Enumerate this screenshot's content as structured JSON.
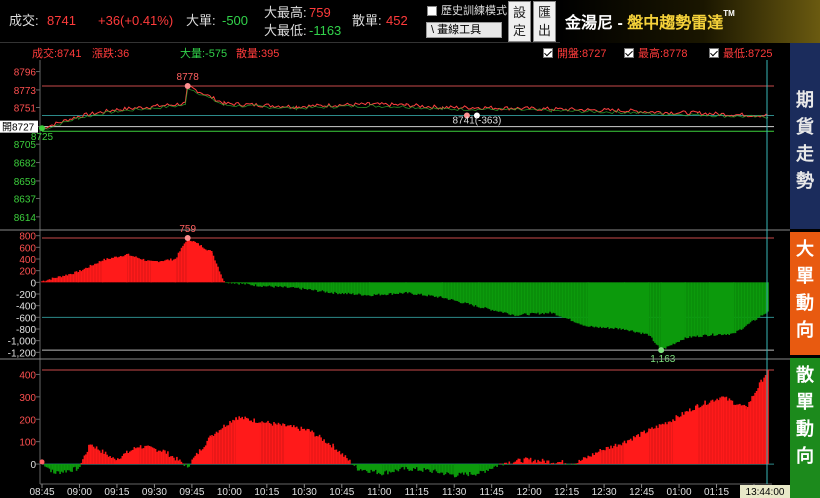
{
  "topbar": {
    "trade_label": "成交:",
    "trade_value": "8741",
    "change_value": "+36(+0.41%)",
    "big_label": "大單:",
    "big_value": "-500",
    "big_max_label": "大最高:",
    "big_max_value": "759",
    "big_min_label": "大最低:",
    "big_min_value": "-1163",
    "retail_label": "散單:",
    "retail_value": "452",
    "history_mode_label": "歷史訓練模式",
    "draw_tool_label": "\\ 畫線工具",
    "settings_label": "設定",
    "export_label": "匯出"
  },
  "brand": {
    "name": "金湯尼",
    "dash": " - ",
    "product": "盤中趨勢雷達",
    "tm": "TM"
  },
  "legend": {
    "trade_text": "成交:8741",
    "change_text": "漲跌:36",
    "big_text": "大量:-575",
    "retail_text": "散量:395",
    "open_text": "開盤:8727",
    "high_text": "最高:8778",
    "low_text": "最低:8725"
  },
  "side_tabs": {
    "futures_trend": "期貨走勢",
    "big_direction": "大單動向",
    "retail_direction": "散單動向"
  },
  "chart_data": [
    {
      "type": "line",
      "name": "price",
      "yticks": [
        8796,
        8773,
        8751,
        8727,
        8705,
        8682,
        8659,
        8637,
        8614
      ],
      "ylim": [
        8600,
        8808
      ],
      "open_label": "開8727",
      "annotations": [
        {
          "x": "09:45",
          "y": 8778,
          "label": "8778"
        },
        {
          "x": "08:45",
          "y": 8725,
          "label": "8725"
        },
        {
          "x": "11:40",
          "y": 8741,
          "label": "8741(-363)"
        }
      ],
      "x": [
        "08:45",
        "09:00",
        "09:15",
        "09:30",
        "09:44",
        "09:45",
        "10:00",
        "10:15",
        "10:30",
        "10:45",
        "11:00",
        "11:15",
        "11:30",
        "11:45",
        "12:00",
        "12:15",
        "12:30",
        "12:45",
        "13:00",
        "13:15",
        "13:30",
        "13:44"
      ],
      "values": [
        8725,
        8740,
        8748,
        8752,
        8756,
        8778,
        8756,
        8754,
        8752,
        8754,
        8755,
        8754,
        8751,
        8751,
        8750,
        8749,
        8748,
        8747,
        8745,
        8744,
        8742,
        8741
      ]
    },
    {
      "type": "area",
      "name": "big_orders",
      "yticks": [
        "800",
        "600",
        "400",
        "200",
        "0",
        "-200",
        "-400",
        "-600",
        "-800",
        "-1,000",
        "-1,200"
      ],
      "ylim": [
        -1280,
        880
      ],
      "annotations": [
        {
          "x": "09:45",
          "y": 759,
          "label": "759"
        },
        {
          "x": "13:00",
          "y": -1163,
          "label": "-1,163"
        }
      ],
      "x": [
        "08:45",
        "09:00",
        "09:10",
        "09:20",
        "09:30",
        "09:40",
        "09:45",
        "09:55",
        "10:00",
        "10:15",
        "10:30",
        "10:45",
        "11:00",
        "11:15",
        "11:30",
        "11:45",
        "12:00",
        "12:15",
        "12:30",
        "12:45",
        "12:55",
        "13:00",
        "13:10",
        "13:20",
        "13:30",
        "13:44"
      ],
      "values": [
        20,
        180,
        380,
        480,
        350,
        400,
        759,
        520,
        10,
        -60,
        -100,
        -180,
        -220,
        -180,
        -260,
        -420,
        -560,
        -520,
        -760,
        -800,
        -900,
        -1163,
        -950,
        -900,
        -880,
        -500
      ]
    },
    {
      "type": "area",
      "name": "retail_orders",
      "yticks": [
        "400",
        "300",
        "200",
        "100",
        "0"
      ],
      "ylim": [
        -80,
        460
      ],
      "x": [
        "08:45",
        "08:50",
        "09:00",
        "09:05",
        "09:15",
        "09:25",
        "09:35",
        "09:45",
        "09:55",
        "10:05",
        "10:15",
        "10:25",
        "10:35",
        "10:45",
        "10:55",
        "11:05",
        "11:15",
        "11:25",
        "11:35",
        "11:45",
        "11:55",
        "12:05",
        "12:15",
        "12:25",
        "12:35",
        "12:45",
        "12:55",
        "13:05",
        "13:15",
        "13:25",
        "13:35",
        "13:44"
      ],
      "values": [
        10,
        -40,
        -20,
        90,
        20,
        80,
        60,
        -10,
        130,
        210,
        190,
        170,
        150,
        80,
        -20,
        -40,
        -20,
        -30,
        -50,
        -40,
        5,
        20,
        10,
        5,
        60,
        100,
        150,
        200,
        260,
        300,
        250,
        420
      ]
    },
    {
      "type": "axis",
      "name": "time",
      "tick_labels": [
        "08:45",
        "09:00",
        "09:15",
        "09:30",
        "09:45",
        "10:00",
        "10:15",
        "10:30",
        "10:45",
        "11:00",
        "11:15",
        "11:30",
        "11:45",
        "12:00",
        "12:15",
        "12:30",
        "12:45",
        "01:00",
        "01:15",
        "01:30"
      ],
      "cursor_label": "13:44:00"
    }
  ]
}
